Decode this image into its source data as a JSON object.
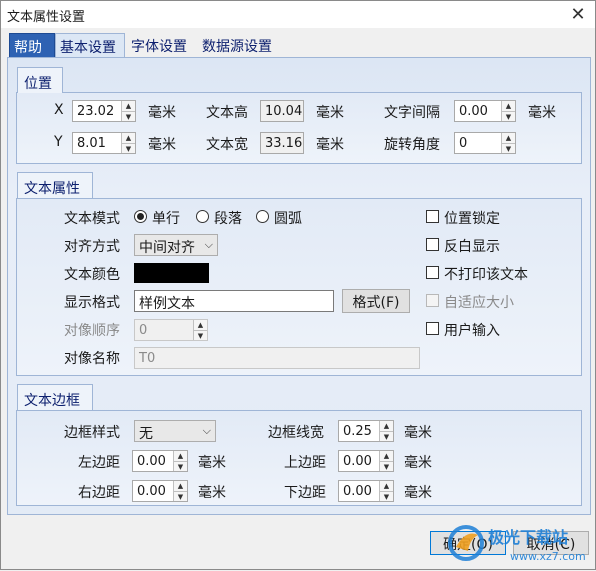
{
  "window": {
    "title": "文本属性设置"
  },
  "tabs": [
    {
      "label": "帮助"
    },
    {
      "label": "基本设置"
    },
    {
      "label": "字体设置"
    },
    {
      "label": "数据源设置"
    }
  ],
  "position": {
    "title": "位置",
    "x_label": "X",
    "x_value": "23.02",
    "y_label": "Y",
    "y_value": "8.01",
    "unit": "毫米",
    "height_label": "文本高",
    "height_value": "10.04",
    "width_label": "文本宽",
    "width_value": "33.16",
    "spacing_label": "文字间隔",
    "spacing_value": "0.00",
    "rotation_label": "旋转角度",
    "rotation_value": "0"
  },
  "text_props": {
    "title": "文本属性",
    "mode_label": "文本模式",
    "mode_options": [
      "单行",
      "段落",
      "圆弧"
    ],
    "mode_selected": "单行",
    "align_label": "对齐方式",
    "align_value": "中间对齐",
    "color_label": "文本颜色",
    "color_value": "#000000",
    "format_label": "显示格式",
    "format_value": "样例文本",
    "format_button": "格式(F)",
    "order_label": "对像顺序",
    "order_value": "0",
    "name_label": "对像名称",
    "name_value": "T0",
    "checkboxes": [
      "位置锁定",
      "反白显示",
      "不打印该文本",
      "自适应大小",
      "用户输入"
    ]
  },
  "border": {
    "title": "文本边框",
    "style_label": "边框样式",
    "style_value": "无",
    "line_width_label": "边框线宽",
    "line_width_value": "0.25",
    "left_label": "左边距",
    "left_value": "0.00",
    "right_label": "右边距",
    "right_value": "0.00",
    "top_label": "上边距",
    "top_value": "0.00",
    "bottom_label": "下边距",
    "bottom_value": "0.00",
    "unit": "毫米"
  },
  "buttons": {
    "ok": "确定(O)",
    "cancel": "取消(C)"
  },
  "watermark": {
    "line1": "极光下载站",
    "line2": "www.xz7.com"
  },
  "colors": {
    "accent": "#2e62b3",
    "panel": "#dce6f4",
    "watermark": "#1d7fd6"
  }
}
